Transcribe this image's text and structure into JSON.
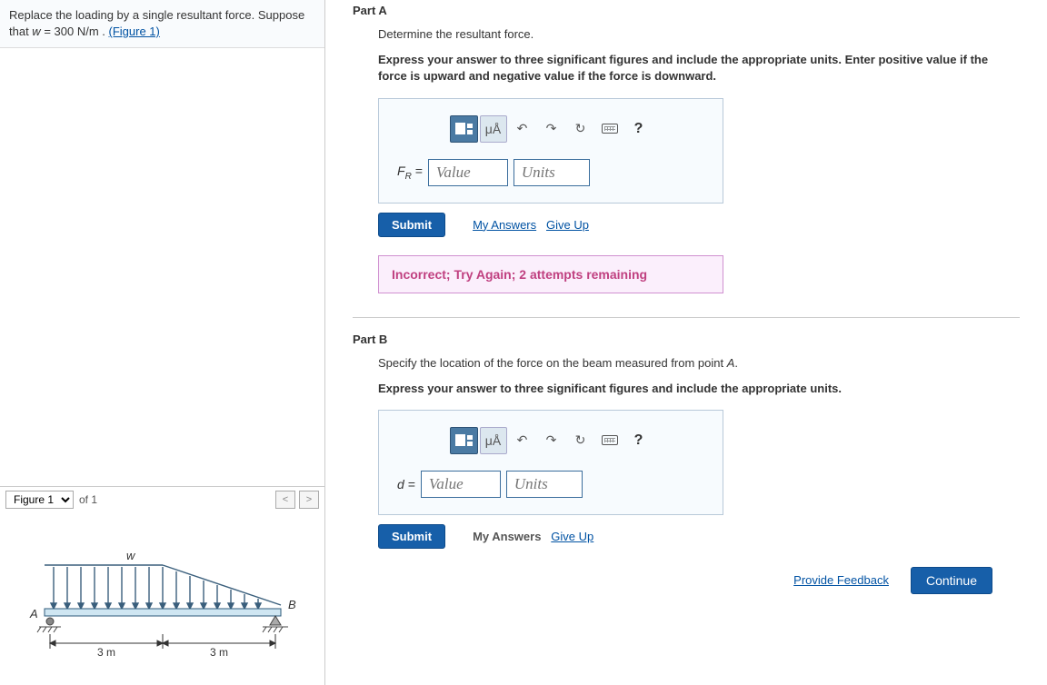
{
  "problem": {
    "text_prefix": "Replace the loading by a single resultant force. Suppose that ",
    "var": "w",
    "eq": " = 300  N/m",
    "text_suffix": " . ",
    "figure_link": "(Figure 1)"
  },
  "figure": {
    "select_label": "Figure 1",
    "of_label": "of 1",
    "labels": {
      "w": "w",
      "A": "A",
      "B": "B",
      "left_dim": "3 m",
      "right_dim": "3 m"
    }
  },
  "chart_data": {
    "type": "diagram",
    "description": "Simply supported beam AB of total length 6 m (3 m + 3 m). Uniform distributed load w over left 3 m, linearly decreasing (triangular) load from w to 0 over right 3 m.",
    "w_Npm": 300,
    "span_left_m": 3,
    "span_right_m": 3,
    "load_left": {
      "shape": "uniform",
      "peak_Npm": 300,
      "length_m": 3
    },
    "load_right": {
      "shape": "triangular_decreasing",
      "peak_Npm": 300,
      "length_m": 3
    }
  },
  "partA": {
    "title": "Part A",
    "instruction": "Determine the resultant force.",
    "instruction_bold": "Express your answer to three significant figures and include the appropriate units. Enter positive value if the force is upward and negative value if the force is downward.",
    "var_html": "F",
    "var_sub": "R",
    "eq_sign": " = ",
    "value_placeholder": "Value",
    "units_placeholder": "Units",
    "submit": "Submit",
    "my_answers": "My Answers",
    "give_up": "Give Up",
    "feedback": "Incorrect; Try Again; 2 attempts remaining",
    "toolbar": {
      "mu_a": "μÅ",
      "question": "?"
    }
  },
  "partB": {
    "title": "Part B",
    "instruction_prefix": "Specify the location of the force on the beam measured from point ",
    "instruction_var": "A",
    "instruction_suffix": ".",
    "instruction_bold": "Express your answer to three significant figures and include the appropriate units.",
    "var_html": "d",
    "eq_sign": " = ",
    "value_placeholder": "Value",
    "units_placeholder": "Units",
    "submit": "Submit",
    "my_answers": "My Answers",
    "give_up": "Give Up",
    "toolbar": {
      "mu_a": "μÅ",
      "question": "?"
    }
  },
  "footer": {
    "provide_feedback": "Provide Feedback",
    "continue": "Continue"
  }
}
